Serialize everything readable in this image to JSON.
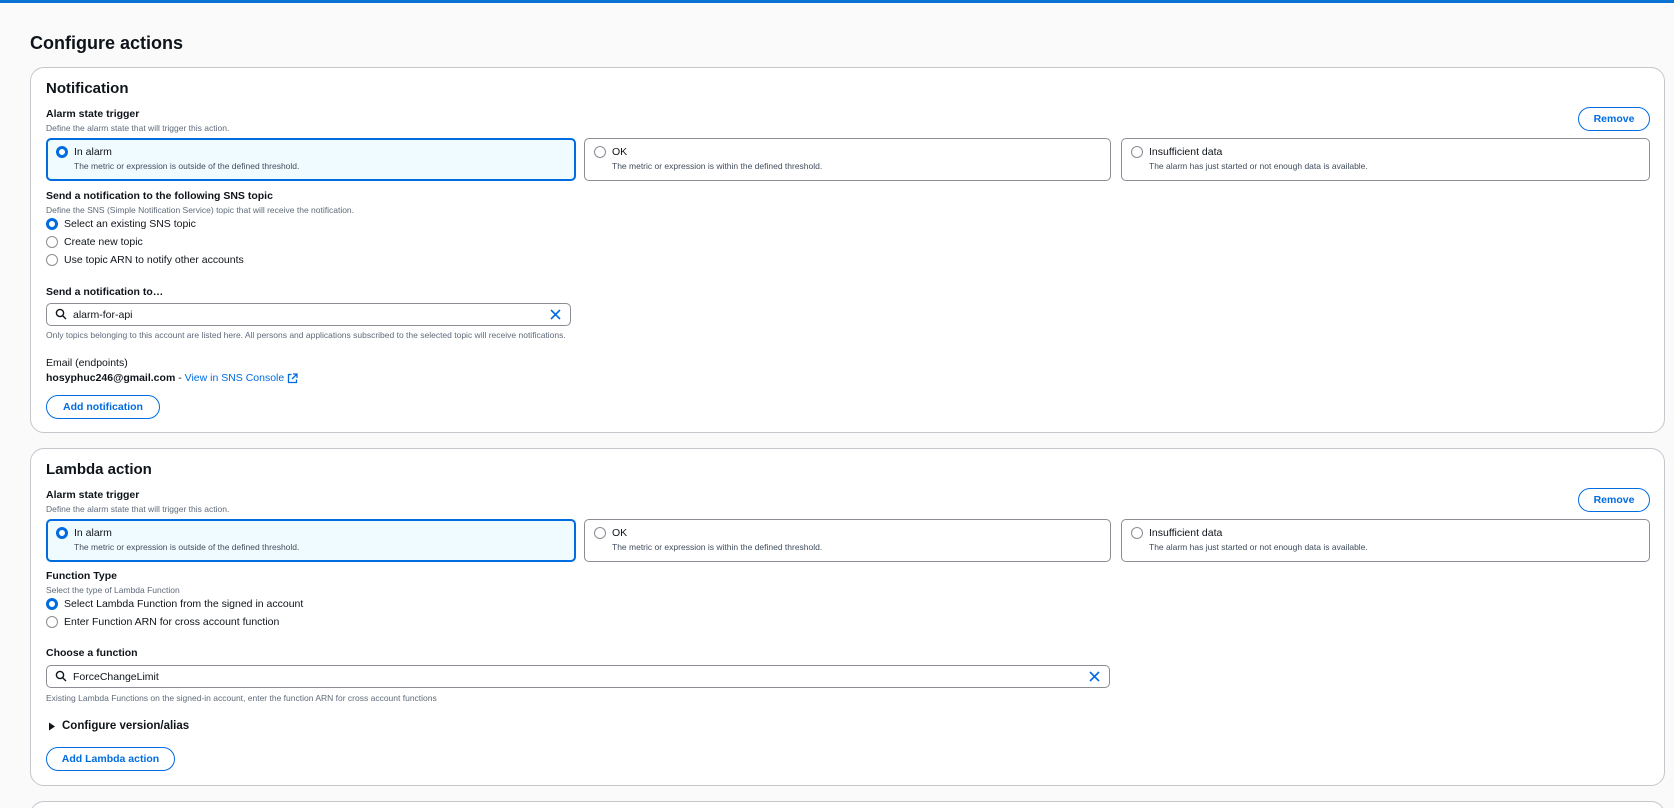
{
  "page_title": "Configure actions",
  "notification": {
    "title": "Notification",
    "remove_label": "Remove",
    "trigger_label": "Alarm state trigger",
    "trigger_desc": "Define the alarm state that will trigger this action.",
    "states": [
      {
        "title": "In alarm",
        "desc": "The metric or expression is outside of the defined threshold.",
        "selected": true
      },
      {
        "title": "OK",
        "desc": "The metric or expression is within the defined threshold.",
        "selected": false
      },
      {
        "title": "Insufficient data",
        "desc": "The alarm has just started or not enough data is available.",
        "selected": false
      }
    ],
    "sns_label": "Send a notification to the following SNS topic",
    "sns_desc": "Define the SNS (Simple Notification Service) topic that will receive the notification.",
    "sns_options": [
      "Select an existing SNS topic",
      "Create new topic",
      "Use topic ARN to notify other accounts"
    ],
    "send_to_label": "Send a notification to…",
    "send_to_value": "alarm-for-api",
    "send_to_hint": "Only topics belonging to this account are listed here. All persons and applications subscribed to the selected topic will receive notifications.",
    "email_label": "Email (endpoints)",
    "email_value": "hosyphuc246@gmail.com",
    "email_sep": " - ",
    "sns_console_link": "View in SNS Console",
    "add_label": "Add notification"
  },
  "lambda": {
    "title": "Lambda action",
    "remove_label": "Remove",
    "trigger_label": "Alarm state trigger",
    "trigger_desc": "Define the alarm state that will trigger this action.",
    "states": [
      {
        "title": "In alarm",
        "desc": "The metric or expression is outside of the defined threshold.",
        "selected": true
      },
      {
        "title": "OK",
        "desc": "The metric or expression is within the defined threshold.",
        "selected": false
      },
      {
        "title": "Insufficient data",
        "desc": "The alarm has just started or not enough data is available.",
        "selected": false
      }
    ],
    "func_type_label": "Function Type",
    "func_type_desc": "Select the type of Lambda Function",
    "func_type_options": [
      "Select Lambda Function from the signed in account",
      "Enter Function ARN for cross account function"
    ],
    "choose_label": "Choose a function",
    "choose_value": "ForceChangeLimit",
    "choose_hint": "Existing Lambda Functions on the signed-in account, enter the function ARN for cross account functions",
    "version_label": "Configure version/alias",
    "add_label": "Add Lambda action"
  },
  "colors": {
    "accent": "#006ce0",
    "top_bar": "#0972d3",
    "selected_bg": "#f0fbff"
  }
}
